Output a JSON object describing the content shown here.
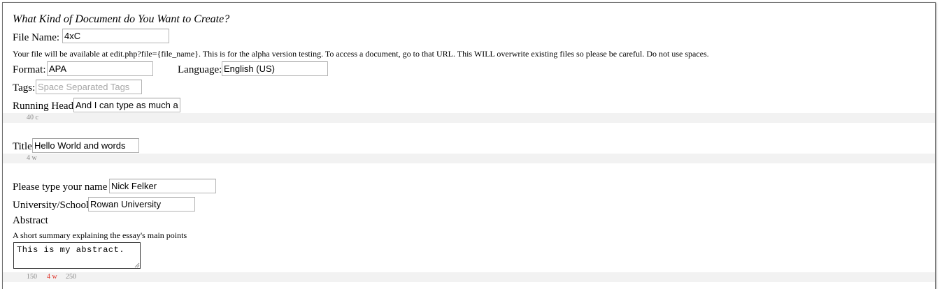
{
  "form": {
    "heading": "What Kind of Document do You Want to Create?",
    "file_name": {
      "label": "File Name:",
      "value": "4xC"
    },
    "file_note": "Your file will be available at edit.php?file={file_name}. This is for the alpha version testing. To access a document, go to that URL. This WILL overwrite existing files so please be careful. Do not use spaces.",
    "format": {
      "label": "Format:",
      "value": "APA"
    },
    "language": {
      "label": "Language:",
      "value": "English (US)"
    },
    "tags": {
      "label": "Tags:",
      "value": "",
      "placeholder": "Space Separated Tags"
    },
    "running_head": {
      "label": "Running Head",
      "value": "And I can type as much a",
      "counter": "40 c"
    },
    "title": {
      "label": "Title",
      "value": "Hello World and words",
      "counter": "4 w"
    },
    "name": {
      "label": "Please type your name",
      "value": "Nick Felker"
    },
    "school": {
      "label": "University/School",
      "value": "Rowan University"
    },
    "abstract": {
      "label": "Abstract",
      "description": "A short summary explaining the essay's main points",
      "value": "This is my abstract.",
      "counter_min": "150",
      "counter_current": "4 w",
      "counter_max": "250",
      "counter_current_color": "#e0362c"
    }
  }
}
